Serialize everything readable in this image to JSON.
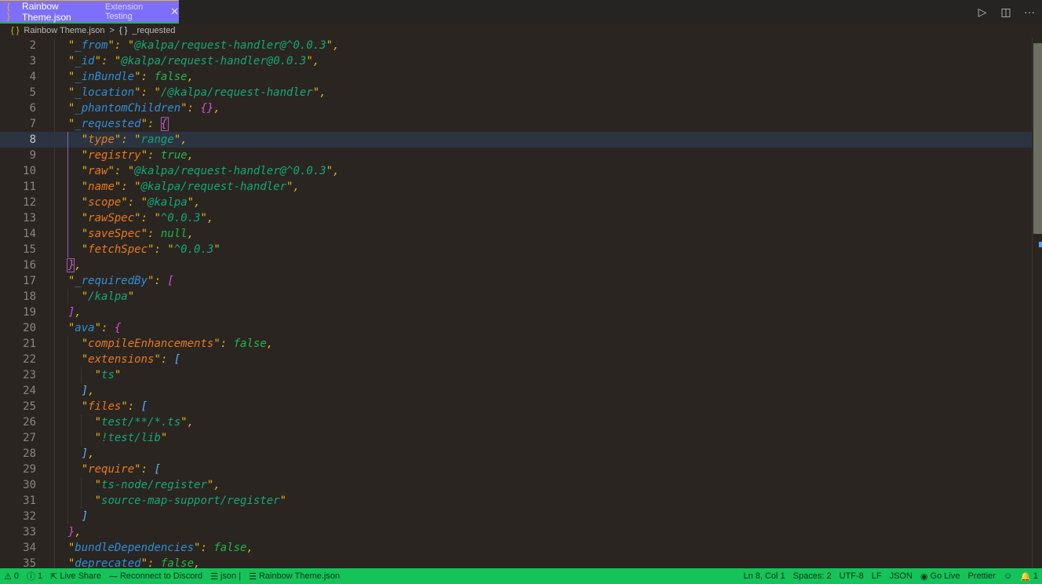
{
  "tab": {
    "icon": "json-braces-icon",
    "icon_glyph": "{ }",
    "title": "Rainbow Theme.json",
    "description": "Extension Testing",
    "close_glyph": "✕"
  },
  "actions": [
    {
      "name": "run-icon",
      "glyph": "▷"
    },
    {
      "name": "split-editor-icon",
      "glyph": "◫"
    },
    {
      "name": "more-actions-icon",
      "glyph": "···"
    }
  ],
  "breadcrumb": {
    "file_icon": "{ }",
    "file": "Rainbow Theme.json",
    "separator": ">",
    "symbol_icon": "{ }",
    "symbol": "_requested"
  },
  "editor": {
    "current_line": 8,
    "lines": [
      {
        "n": "2",
        "indent": 1,
        "key": "_from",
        "keyLevel": 1,
        "value": "\"@kalpa/request-handler@^0.0.3\"",
        "vtype": "s",
        "trail": ","
      },
      {
        "n": "3",
        "indent": 1,
        "key": "_id",
        "keyLevel": 1,
        "value": "\"@kalpa/request-handler@0.0.3\"",
        "vtype": "s",
        "trail": ","
      },
      {
        "n": "4",
        "indent": 1,
        "key": "_inBundle",
        "keyLevel": 1,
        "value": "false",
        "vtype": "b",
        "trail": ","
      },
      {
        "n": "5",
        "indent": 1,
        "key": "_location",
        "keyLevel": 1,
        "value": "\"/@kalpa/request-handler\"",
        "vtype": "s",
        "trail": ","
      },
      {
        "n": "6",
        "indent": 1,
        "key": "_phantomChildren",
        "keyLevel": 1,
        "value": "{}",
        "vtype": "br1",
        "trail": ","
      },
      {
        "n": "7",
        "indent": 1,
        "key": "_requested",
        "keyLevel": 1,
        "value": "{",
        "vtype": "br1",
        "trail": ""
      },
      {
        "n": "8",
        "indent": 2,
        "key": "type",
        "keyLevel": 2,
        "value": "\"range\"",
        "vtype": "s",
        "trail": ","
      },
      {
        "n": "9",
        "indent": 2,
        "key": "registry",
        "keyLevel": 2,
        "value": "true",
        "vtype": "b",
        "trail": ","
      },
      {
        "n": "10",
        "indent": 2,
        "key": "raw",
        "keyLevel": 2,
        "value": "\"@kalpa/request-handler@^0.0.3\"",
        "vtype": "s",
        "trail": ","
      },
      {
        "n": "11",
        "indent": 2,
        "key": "name",
        "keyLevel": 2,
        "value": "\"@kalpa/request-handler\"",
        "vtype": "s",
        "trail": ","
      },
      {
        "n": "12",
        "indent": 2,
        "key": "scope",
        "keyLevel": 2,
        "value": "\"@kalpa\"",
        "vtype": "s",
        "trail": ","
      },
      {
        "n": "13",
        "indent": 2,
        "key": "rawSpec",
        "keyLevel": 2,
        "value": "\"^0.0.3\"",
        "vtype": "s",
        "trail": ","
      },
      {
        "n": "14",
        "indent": 2,
        "key": "saveSpec",
        "keyLevel": 2,
        "value": "null",
        "vtype": "b",
        "trail": ","
      },
      {
        "n": "15",
        "indent": 2,
        "key": "fetchSpec",
        "keyLevel": 2,
        "value": "\"^0.0.3\"",
        "vtype": "s",
        "trail": ""
      },
      {
        "n": "16",
        "indent": 1,
        "key": null,
        "value": "}",
        "vtype": "br1",
        "trail": ","
      },
      {
        "n": "17",
        "indent": 1,
        "key": "_requiredBy",
        "keyLevel": 1,
        "value": "[",
        "vtype": "br1",
        "trail": ""
      },
      {
        "n": "18",
        "indent": 2,
        "key": null,
        "value": "\"/kalpa\"",
        "vtype": "s",
        "trail": ""
      },
      {
        "n": "19",
        "indent": 1,
        "key": null,
        "value": "]",
        "vtype": "br1",
        "trail": ","
      },
      {
        "n": "20",
        "indent": 1,
        "key": "ava",
        "keyLevel": 1,
        "value": "{",
        "vtype": "br1",
        "trail": ""
      },
      {
        "n": "21",
        "indent": 2,
        "key": "compileEnhancements",
        "keyLevel": 2,
        "value": "false",
        "vtype": "b",
        "trail": ","
      },
      {
        "n": "22",
        "indent": 2,
        "key": "extensions",
        "keyLevel": 2,
        "value": "[",
        "vtype": "br2",
        "trail": ""
      },
      {
        "n": "23",
        "indent": 3,
        "key": null,
        "value": "\"ts\"",
        "vtype": "s",
        "trail": ""
      },
      {
        "n": "24",
        "indent": 2,
        "key": null,
        "value": "]",
        "vtype": "br2",
        "trail": ","
      },
      {
        "n": "25",
        "indent": 2,
        "key": "files",
        "keyLevel": 2,
        "value": "[",
        "vtype": "br2",
        "trail": ""
      },
      {
        "n": "26",
        "indent": 3,
        "key": null,
        "value": "\"test/**/*.ts\"",
        "vtype": "s",
        "trail": ","
      },
      {
        "n": "27",
        "indent": 3,
        "key": null,
        "value": "\"!test/lib\"",
        "vtype": "s",
        "trail": ""
      },
      {
        "n": "28",
        "indent": 2,
        "key": null,
        "value": "]",
        "vtype": "br2",
        "trail": ","
      },
      {
        "n": "29",
        "indent": 2,
        "key": "require",
        "keyLevel": 2,
        "value": "[",
        "vtype": "br2",
        "trail": ""
      },
      {
        "n": "30",
        "indent": 3,
        "key": null,
        "value": "\"ts-node/register\"",
        "vtype": "s",
        "trail": ","
      },
      {
        "n": "31",
        "indent": 3,
        "key": null,
        "value": "\"source-map-support/register\"",
        "vtype": "s",
        "trail": ""
      },
      {
        "n": "32",
        "indent": 2,
        "key": null,
        "value": "]",
        "vtype": "br2",
        "trail": ""
      },
      {
        "n": "33",
        "indent": 1,
        "key": null,
        "value": "}",
        "vtype": "br1",
        "trail": ","
      },
      {
        "n": "34",
        "indent": 1,
        "key": "bundleDependencies",
        "keyLevel": 1,
        "value": "false",
        "vtype": "b",
        "trail": ","
      },
      {
        "n": "35",
        "indent": 1,
        "key": "deprecated",
        "keyLevel": 1,
        "value": "false",
        "vtype": "b",
        "trail": ","
      }
    ]
  },
  "statusbar": {
    "left": [
      {
        "name": "problems-warnings",
        "icon": "warning-icon",
        "glyph": "⚠",
        "label": "0"
      },
      {
        "name": "problems-info",
        "icon": "info-icon",
        "glyph": "ⓘ",
        "label": "1"
      },
      {
        "name": "live-share",
        "icon": "live-share-icon",
        "glyph": "⇱",
        "label": "Live Share"
      },
      {
        "name": "discord",
        "icon": "pulse-icon",
        "glyph": "⁓",
        "label": "Reconnect to Discord"
      },
      {
        "name": "language-json",
        "icon": "list-icon",
        "glyph": "☰",
        "label": "json |"
      },
      {
        "name": "file-name",
        "icon": "list-icon",
        "glyph": "☰",
        "label": "Rainbow Theme.json"
      }
    ],
    "right": [
      {
        "name": "cursor-position",
        "label": "Ln 8, Col 1"
      },
      {
        "name": "indentation",
        "label": "Spaces: 2"
      },
      {
        "name": "encoding",
        "label": "UTF-8"
      },
      {
        "name": "eol",
        "label": "LF"
      },
      {
        "name": "language-mode",
        "label": "JSON"
      },
      {
        "name": "go-live",
        "icon": "broadcast-icon",
        "glyph": "◉",
        "label": "Go Live"
      },
      {
        "name": "prettier",
        "label": "Prettier"
      },
      {
        "name": "feedback",
        "icon": "feedback-icon",
        "glyph": "☺",
        "label": ""
      },
      {
        "name": "notifications",
        "icon": "bell-icon",
        "glyph": "🔔",
        "label": "1"
      }
    ]
  },
  "colors": {
    "tab_bg": "#7d6ff7",
    "statusbar_bg": "#14c45a",
    "editor_bg": "#2a2521",
    "key_level1": "#2f8fd8",
    "key_level2": "#e87a1e",
    "string": "#14a878",
    "literal": "#23b54a",
    "punctuation": "#e2b714",
    "bracket_level1": "#d94fd9",
    "bracket_level2": "#5ab0ff"
  }
}
